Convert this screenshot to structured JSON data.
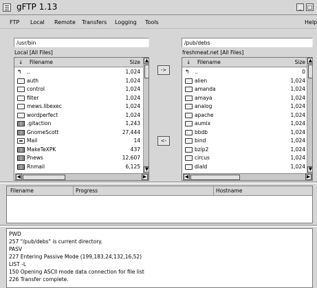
{
  "window": {
    "title": "gFTP 1.13",
    "minimize_label": "_",
    "maximize_label": "□"
  },
  "menubar": {
    "items": [
      "FTP",
      "Local",
      "Remote",
      "Transfers",
      "Logging",
      "Tools"
    ],
    "help": "Help"
  },
  "local": {
    "path": "/usr/bin",
    "label": "Local [All Files]",
    "sort_icon": "↓",
    "col_filename": "Filename",
    "col_size": "Size",
    "files": [
      {
        "name": "..",
        "size": "1,024",
        "icon": "updir"
      },
      {
        "name": "auth",
        "size": "1,024",
        "icon": "folder"
      },
      {
        "name": "control",
        "size": "1,024",
        "icon": "folder"
      },
      {
        "name": "filter",
        "size": "1,024",
        "icon": "folder"
      },
      {
        "name": "mews.libexec",
        "size": "1,024",
        "icon": "folder"
      },
      {
        "name": "wordperfect",
        "size": "1,024",
        "icon": "folder"
      },
      {
        "name": ".gitaction",
        "size": "1,243",
        "icon": "exec"
      },
      {
        "name": "GnomeScott",
        "size": "27,444",
        "icon": "exec"
      },
      {
        "name": "Mail",
        "size": "14",
        "icon": "link"
      },
      {
        "name": "MakeTeXPK",
        "size": "437",
        "icon": "exec"
      },
      {
        "name": "Pnews",
        "size": "12,607",
        "icon": "exec"
      },
      {
        "name": "Rnmail",
        "size": "6,125",
        "icon": "exec"
      }
    ]
  },
  "remote": {
    "path": "/pub/debs",
    "label": "freshmeat.net [All Files]",
    "sort_icon": "↓",
    "col_filename": "Filename",
    "col_size": "Size",
    "files": [
      {
        "name": "..",
        "size": "0",
        "icon": "updir"
      },
      {
        "name": "alien",
        "size": "1,024",
        "icon": "folder"
      },
      {
        "name": "amanda",
        "size": "1,024",
        "icon": "folder"
      },
      {
        "name": "amaya",
        "size": "1,024",
        "icon": "folder"
      },
      {
        "name": "analog",
        "size": "1,024",
        "icon": "folder"
      },
      {
        "name": "apache",
        "size": "1,024",
        "icon": "folder"
      },
      {
        "name": "aumix",
        "size": "1,024",
        "icon": "folder"
      },
      {
        "name": "bbdb",
        "size": "1,024",
        "icon": "folder"
      },
      {
        "name": "bind",
        "size": "1,024",
        "icon": "folder"
      },
      {
        "name": "bzip2",
        "size": "1,024",
        "icon": "folder"
      },
      {
        "name": "circus",
        "size": "1,024",
        "icon": "folder"
      },
      {
        "name": "diald",
        "size": "1,024",
        "icon": "folder"
      }
    ]
  },
  "transfer_buttons": {
    "to_remote": "->",
    "to_local": "<-"
  },
  "transfers": {
    "col_filename": "Filename",
    "col_progress": "Progress",
    "col_hostname": "Hostname"
  },
  "log": {
    "lines": [
      "PWD",
      "257 \"/pub/debs\" is current directory.",
      "PASV",
      "227 Entering Passive Mode (199,183,24,132,16,52)",
      "LIST -L",
      "150 Opening ASCII mode data connection for file list",
      "226 Transfer complete."
    ]
  }
}
